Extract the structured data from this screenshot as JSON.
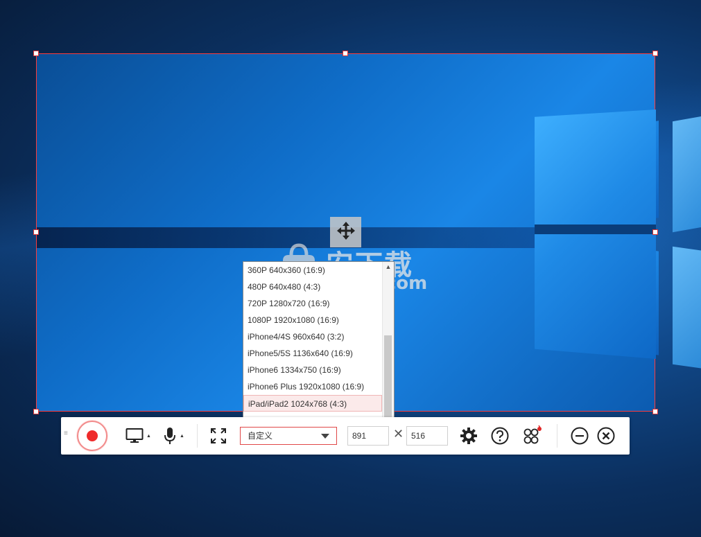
{
  "watermark": {
    "cn": "安下载",
    "en": "anxz.com"
  },
  "resolution_list": {
    "items": [
      "360P 640x360 (16:9)",
      "480P 640x480 (4:3)",
      "720P 1280x720 (16:9)",
      "1080P 1920x1080 (16:9)",
      "iPhone4/4S 960x640 (3:2)",
      "iPhone5/5S 1136x640 (16:9)",
      "iPhone6 1334x750 (16:9)",
      "iPhone6 Plus 1920x1080 (16:9)",
      "iPad/iPad2 1024x768 (4:3)"
    ],
    "selected_index": 8
  },
  "toolbar": {
    "preset_value": "自定义",
    "width_value": "891",
    "height_value": "516",
    "times_symbol": "✕"
  },
  "icons": {
    "move": "move-arrows-icon",
    "record": "record-icon",
    "screen": "monitor-icon",
    "mic": "microphone-icon",
    "fullscreen": "fullscreen-icon",
    "settings": "gear-icon",
    "help": "help-icon",
    "effects": "effects-icon",
    "minimize": "minimize-icon",
    "close": "close-icon"
  },
  "colors": {
    "accent": "#e04747",
    "record": "#ef2b2b",
    "selection": "#fbeaea"
  }
}
